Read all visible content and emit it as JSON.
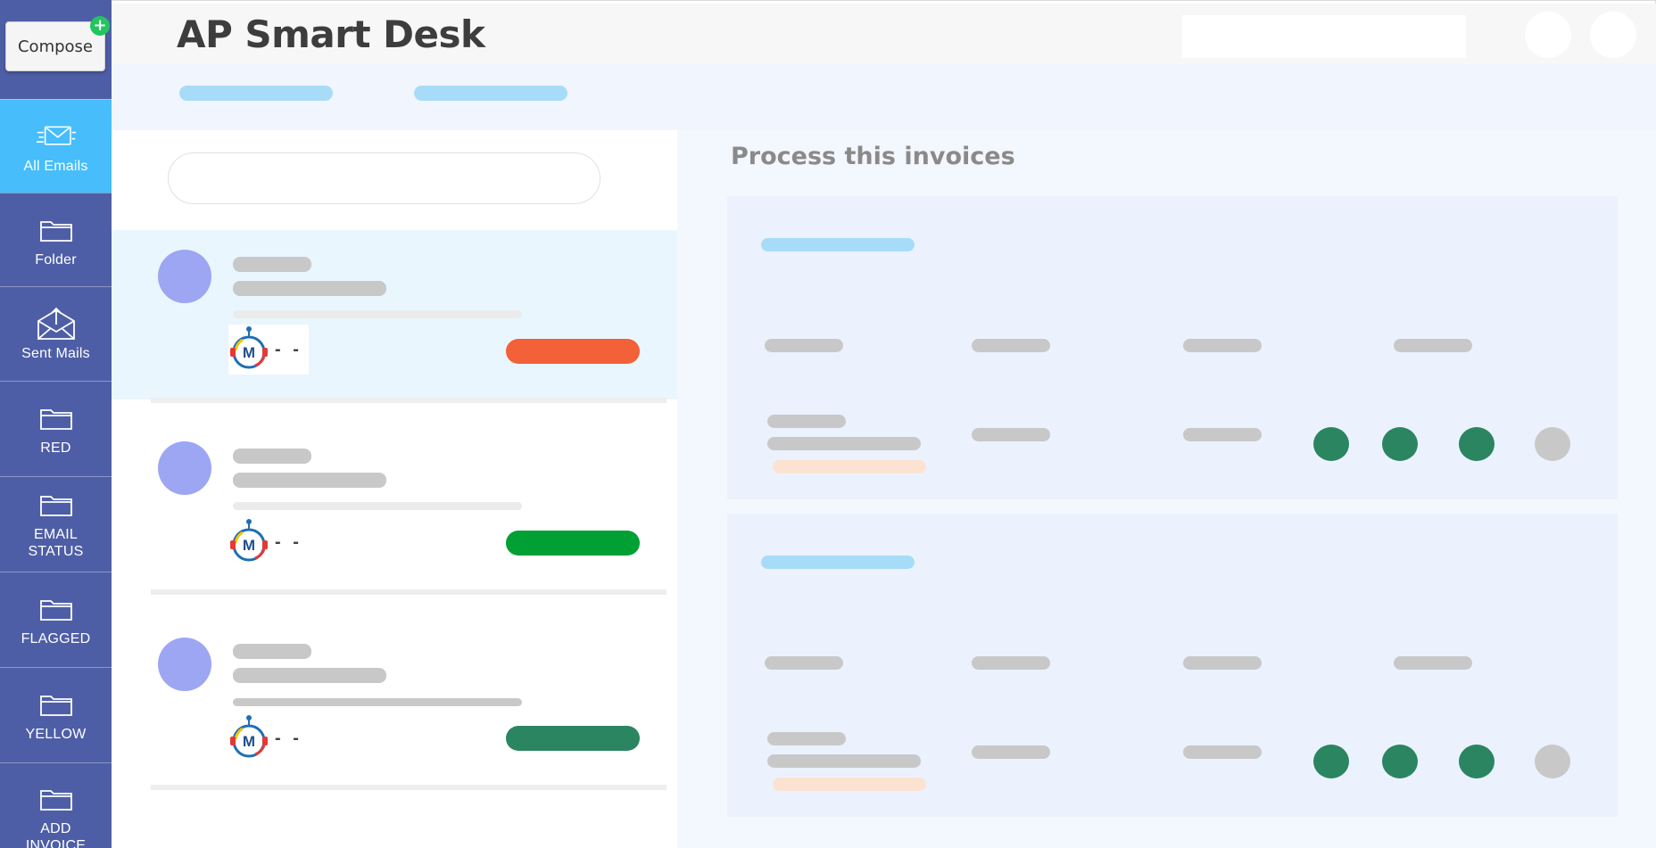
{
  "app": {
    "title": "AP Smart Desk"
  },
  "compose": {
    "label": "Compose",
    "badge": "+"
  },
  "sidebar": {
    "items": [
      {
        "label": "All Emails",
        "icon": "envelope-fast-icon",
        "active": true
      },
      {
        "label": "Folder",
        "icon": "folder-icon",
        "active": false
      },
      {
        "label": "Sent Mails",
        "icon": "envelope-open-icon",
        "active": false
      },
      {
        "label": "RED",
        "icon": "folder-icon",
        "active": false
      },
      {
        "label": "EMAIL\nSTATUS",
        "icon": "folder-icon",
        "active": false
      },
      {
        "label": "FLAGGED",
        "icon": "folder-icon",
        "active": false
      },
      {
        "label": "YELLOW",
        "icon": "folder-icon",
        "active": false
      },
      {
        "label": "ADD\nINVOICE",
        "icon": "folder-icon",
        "active": false
      }
    ]
  },
  "email_list": {
    "items": [
      {
        "sender_icon": "m-logo-icon",
        "dash": "- -",
        "status_color": "#f26138"
      },
      {
        "sender_icon": "m-logo-icon",
        "dash": "- -",
        "status_color": "#00a034"
      },
      {
        "sender_icon": "m-logo-icon",
        "dash": "- -",
        "status_color": "#2a8560"
      }
    ]
  },
  "invoices": {
    "title": "Process this invoices",
    "cards": [
      {
        "dot_colors": [
          "#2a8560",
          "#2a8560",
          "#2a8560",
          "#c8c8c8"
        ]
      },
      {
        "dot_colors": [
          "#2a8560",
          "#2a8560",
          "#2a8560",
          "#c8c8c8"
        ]
      }
    ]
  },
  "colors": {
    "sidebar": "#4e5ea6",
    "sidebar_active": "#47bdfb",
    "skeleton": "#c8c8c8",
    "skeleton_blue": "#a7dcf8",
    "skeleton_peach": "#fce3d1",
    "avatar": "#9ca6f3"
  }
}
